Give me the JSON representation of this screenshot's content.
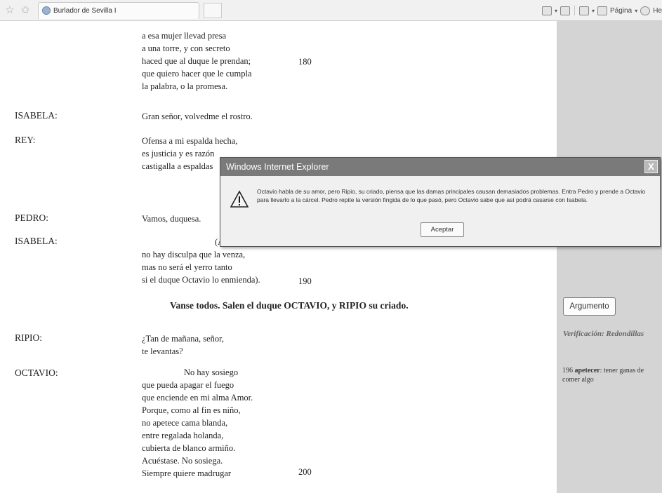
{
  "toolbar": {
    "tab_title": "Burlador de Sevilla I",
    "page_menu": "Página",
    "help_menu": "He"
  },
  "dialog": {
    "title": "Windows Internet Explorer",
    "close_glyph": "X",
    "message": "Octavio habla de su amor, pero Ripio, su criado, piensa que las damas principales causan demasiados problemas. Entra Pedro y prende a Octavio para llevarlo a la cárcel. Pedro repite la versión fingida de lo que pasó, pero Octavio sabe que así podrá casarse con Isabela.",
    "ok_label": "Aceptar"
  },
  "play": {
    "block1": [
      "a esa mujer llevad presa",
      "a una torre, y con secreto",
      "haced que al duque le prendan;",
      "que quiero hacer que le cumpla",
      "la palabra, o la promesa."
    ],
    "num180": "180",
    "isabela_speaker": "ISABELA:",
    "isabela_line": "Gran señor, volvedme el rostro.",
    "rey_speaker": "REY:",
    "rey_lines": [
      "Ofensa a mi espalda hecha,",
      "es justicia y es razón",
      "castigalla a espaldas"
    ],
    "pedro_speaker": "PEDRO:",
    "pedro_line": "Vamos, duquesa.",
    "isabela2_speaker": "ISABELA:",
    "isabela2_fragment": "(A",
    "isabela2_lines": [
      "no hay disculpa que la venza,",
      "mas no será el yerro tanto",
      "si el duque Octavio lo enmienda)."
    ],
    "num190": "190",
    "stage_direction": "Vanse todos. Salen el duque OCTAVIO, y RIPIO su criado.",
    "ripio_speaker": "RIPIO:",
    "ripio_lines": [
      "¿Tan de mañana, señor,",
      "te levantas?"
    ],
    "octavio_speaker": "OCTAVIO:",
    "octavio_first": "No hay sosiego",
    "octavio_lines": [
      "que pueda apagar el fuego",
      "que enciende en mi alma Amor.",
      "Porque, como al fin es niño,",
      "no apetece cama blanda,",
      "entre regalada holanda,",
      "cubierta de blanco armiño.",
      "Acuéstase. No sosiega.",
      "Siempre quiere madrugar"
    ],
    "num200": "200"
  },
  "sidebar": {
    "argument_button": "Argumento",
    "verification": "Verificación: Redondillas",
    "note_number": "196",
    "note_term": "apetecer",
    "note_text": ": tener ganas de comer algo"
  }
}
